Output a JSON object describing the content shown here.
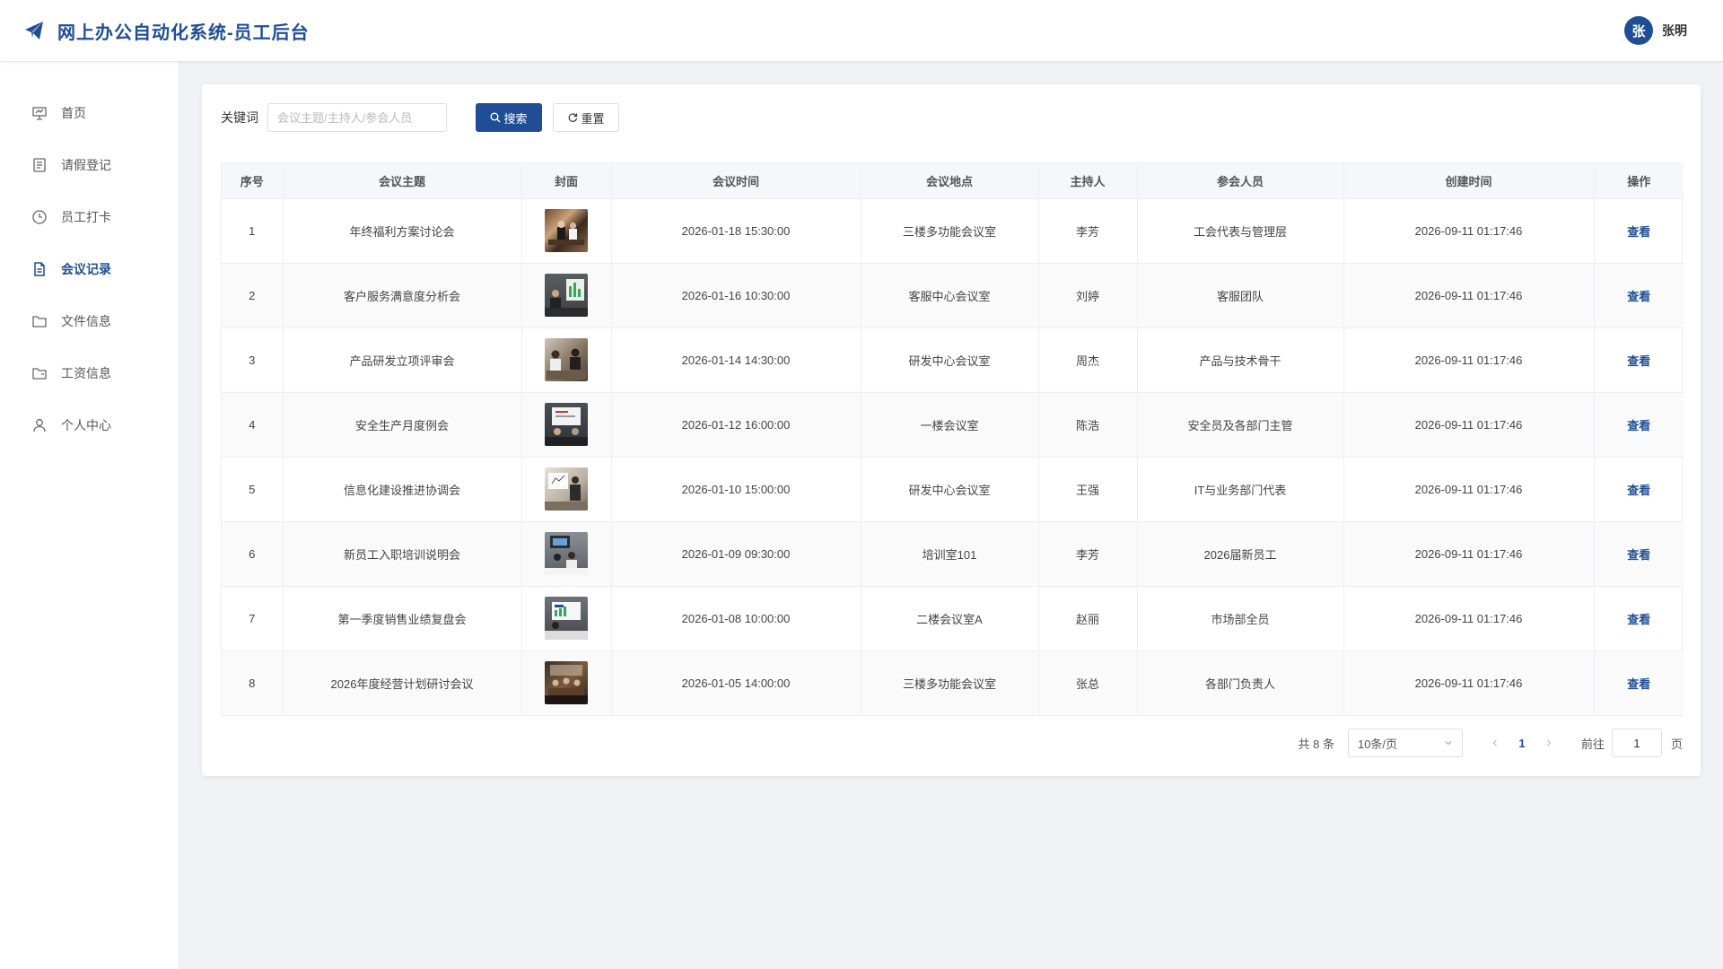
{
  "header": {
    "title": "网上办公自动化系统-员工后台",
    "user": {
      "avatar_text": "张",
      "name": "张明"
    }
  },
  "sidebar": {
    "items": [
      {
        "label": "首页",
        "icon": "presentation-icon",
        "active": false
      },
      {
        "label": "请假登记",
        "icon": "document-icon",
        "active": false
      },
      {
        "label": "员工打卡",
        "icon": "clock-icon",
        "active": false
      },
      {
        "label": "会议记录",
        "icon": "document-text-icon",
        "active": true
      },
      {
        "label": "文件信息",
        "icon": "folder-icon",
        "active": false
      },
      {
        "label": "工资信息",
        "icon": "folder-wallet-icon",
        "active": false
      },
      {
        "label": "个人中心",
        "icon": "user-icon",
        "active": false
      }
    ]
  },
  "search": {
    "label": "关键词",
    "placeholder": "会议主题/主持人/参会人员",
    "value": "",
    "search_button": "搜索",
    "reset_button": "重置"
  },
  "table": {
    "columns": [
      "序号",
      "会议主题",
      "封面",
      "会议时间",
      "会议地点",
      "主持人",
      "参会人员",
      "创建时间",
      "操作"
    ],
    "rows": [
      {
        "no": "1",
        "topic": "年终福利方案讨论会",
        "time": "2026-01-18 15:30:00",
        "place": "三楼多功能会议室",
        "host": "李芳",
        "attendees": "工会代表与管理层",
        "created": "2026-09-11 01:17:46",
        "action": "查看"
      },
      {
        "no": "2",
        "topic": "客户服务满意度分析会",
        "time": "2026-01-16 10:30:00",
        "place": "客服中心会议室",
        "host": "刘婷",
        "attendees": "客服团队",
        "created": "2026-09-11 01:17:46",
        "action": "查看"
      },
      {
        "no": "3",
        "topic": "产品研发立项评审会",
        "time": "2026-01-14 14:30:00",
        "place": "研发中心会议室",
        "host": "周杰",
        "attendees": "产品与技术骨干",
        "created": "2026-09-11 01:17:46",
        "action": "查看"
      },
      {
        "no": "4",
        "topic": "安全生产月度例会",
        "time": "2026-01-12 16:00:00",
        "place": "一楼会议室",
        "host": "陈浩",
        "attendees": "安全员及各部门主管",
        "created": "2026-09-11 01:17:46",
        "action": "查看"
      },
      {
        "no": "5",
        "topic": "信息化建设推进协调会",
        "time": "2026-01-10 15:00:00",
        "place": "研发中心会议室",
        "host": "王强",
        "attendees": "IT与业务部门代表",
        "created": "2026-09-11 01:17:46",
        "action": "查看"
      },
      {
        "no": "6",
        "topic": "新员工入职培训说明会",
        "time": "2026-01-09 09:30:00",
        "place": "培训室101",
        "host": "李芳",
        "attendees": "2026届新员工",
        "created": "2026-09-11 01:17:46",
        "action": "查看"
      },
      {
        "no": "7",
        "topic": "第一季度销售业绩复盘会",
        "time": "2026-01-08 10:00:00",
        "place": "二楼会议室A",
        "host": "赵丽",
        "attendees": "市场部全员",
        "created": "2026-09-11 01:17:46",
        "action": "查看"
      },
      {
        "no": "8",
        "topic": "2026年度经营计划研讨会议",
        "time": "2026-01-05 14:00:00",
        "place": "三楼多功能会议室",
        "host": "张总",
        "attendees": "各部门负责人",
        "created": "2026-09-11 01:17:46",
        "action": "查看"
      }
    ]
  },
  "pagination": {
    "total_text": "共 8 条",
    "page_size": "10条/页",
    "current_page": "1",
    "goto_label": "前往",
    "goto_value": "1",
    "goto_suffix": "页"
  },
  "colors": {
    "primary": "#1f4e96",
    "background": "#f0f2f5"
  }
}
